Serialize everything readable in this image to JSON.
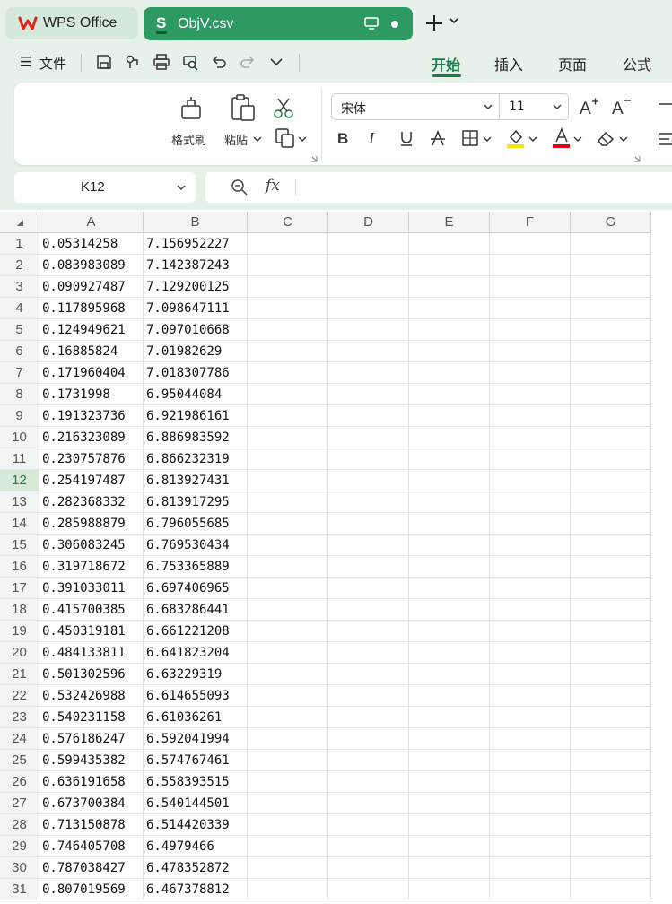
{
  "tabs": {
    "home_label": "WPS Office",
    "doc_label": "ObjV.csv"
  },
  "menu": {
    "file_label": "文件",
    "tabs": [
      "开始",
      "插入",
      "页面",
      "公式"
    ],
    "active_tab": "开始"
  },
  "ribbon": {
    "format_painter_label": "格式刷",
    "paste_label": "粘贴",
    "font_name": "宋体",
    "font_size": "11",
    "icons": [
      "format-painter",
      "paste",
      "cut",
      "copy",
      "bold",
      "italic",
      "underline",
      "strikethrough",
      "borders",
      "fill-color",
      "font-color",
      "clear",
      "increase-font",
      "decrease-font"
    ],
    "fill_color": "#f5e400",
    "font_color": "#e0001b"
  },
  "formula_bar": {
    "cell_ref": "K12",
    "fx_label": "fx",
    "formula": ""
  },
  "sheet": {
    "columns": [
      "A",
      "B",
      "C",
      "D",
      "E",
      "F",
      "G"
    ],
    "active_row": 12,
    "rows": [
      {
        "n": "1",
        "a": "0.05314258",
        "b": "7.156952227"
      },
      {
        "n": "2",
        "a": "0.083983089",
        "b": "7.142387243"
      },
      {
        "n": "3",
        "a": "0.090927487",
        "b": "7.129200125"
      },
      {
        "n": "4",
        "a": "0.117895968",
        "b": "7.098647111"
      },
      {
        "n": "5",
        "a": "0.124949621",
        "b": "7.097010668"
      },
      {
        "n": "6",
        "a": "0.16885824",
        "b": "7.01982629"
      },
      {
        "n": "7",
        "a": "0.171960404",
        "b": "7.018307786"
      },
      {
        "n": "8",
        "a": "0.1731998",
        "b": "6.95044084"
      },
      {
        "n": "9",
        "a": "0.191323736",
        "b": "6.921986161"
      },
      {
        "n": "10",
        "a": "0.216323089",
        "b": "6.886983592"
      },
      {
        "n": "11",
        "a": "0.230757876",
        "b": "6.866232319"
      },
      {
        "n": "12",
        "a": "0.254197487",
        "b": "6.813927431"
      },
      {
        "n": "13",
        "a": "0.282368332",
        "b": "6.813917295"
      },
      {
        "n": "14",
        "a": "0.285988879",
        "b": "6.796055685"
      },
      {
        "n": "15",
        "a": "0.306083245",
        "b": "6.769530434"
      },
      {
        "n": "16",
        "a": "0.319718672",
        "b": "6.753365889"
      },
      {
        "n": "17",
        "a": "0.391033011",
        "b": "6.697406965"
      },
      {
        "n": "18",
        "a": "0.415700385",
        "b": "6.683286441"
      },
      {
        "n": "19",
        "a": "0.450319181",
        "b": "6.661221208"
      },
      {
        "n": "20",
        "a": "0.484133811",
        "b": "6.641823204"
      },
      {
        "n": "21",
        "a": "0.501302596",
        "b": "6.63229319"
      },
      {
        "n": "22",
        "a": "0.532426988",
        "b": "6.614655093"
      },
      {
        "n": "23",
        "a": "0.540231158",
        "b": "6.61036261"
      },
      {
        "n": "24",
        "a": "0.576186247",
        "b": "6.592041994"
      },
      {
        "n": "25",
        "a": "0.599435382",
        "b": "6.574767461"
      },
      {
        "n": "26",
        "a": "0.636191658",
        "b": "6.558393515"
      },
      {
        "n": "27",
        "a": "0.673700384",
        "b": "6.540144501"
      },
      {
        "n": "28",
        "a": "0.713150878",
        "b": "6.514420339"
      },
      {
        "n": "29",
        "a": "0.746405708",
        "b": "6.4979466"
      },
      {
        "n": "30",
        "a": "0.787038427",
        "b": "6.478352872"
      },
      {
        "n": "31",
        "a": "0.807019569",
        "b": "6.467378812"
      }
    ]
  }
}
